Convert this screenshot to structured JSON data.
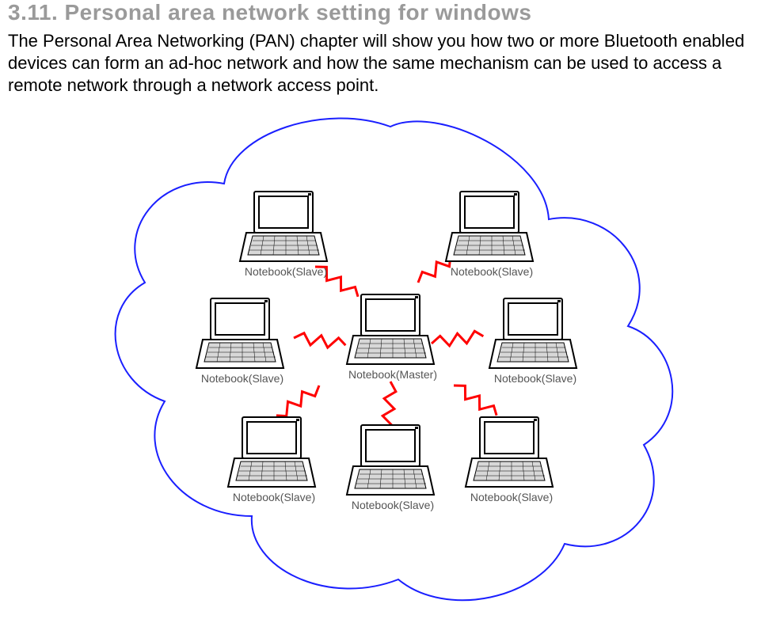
{
  "section": {
    "title": "3.11. Personal area network setting for windows",
    "intro": "The Personal Area Networking (PAN) chapter will show you how two or more Bluetooth enabled devices can form an ad-hoc network and how the same mechanism can be used to access a remote network through a network access point."
  },
  "diagram": {
    "master_label": "Notebook(Master)",
    "slave_label": "Notebook(Slave)",
    "colors": {
      "cloud_stroke": "#1a1fff",
      "link_stroke": "#ff0000",
      "laptop_stroke": "#000000",
      "laptop_fill": "#ffffff",
      "laptop_key_fill": "#d8d8d8"
    }
  }
}
